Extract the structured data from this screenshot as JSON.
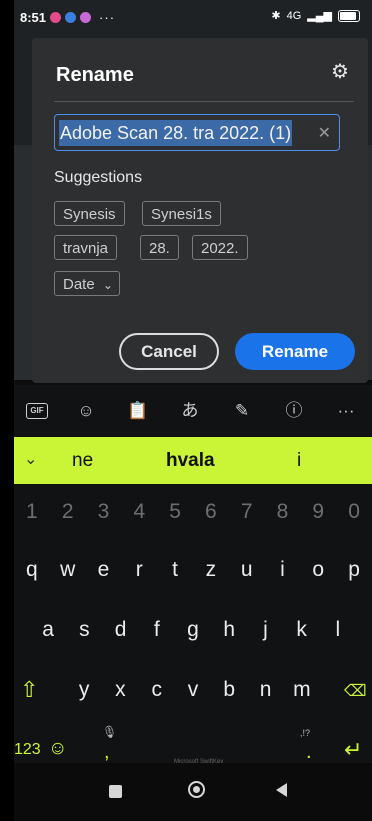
{
  "status_bar": {
    "time": "8:51",
    "more": "···",
    "right_text": "4G"
  },
  "dialog": {
    "title": "Rename",
    "input_value": "Adobe Scan 28. tra 2022. (1)",
    "suggestions_label": "Suggestions",
    "chips_row1": [
      "Synesis",
      "Synesi1s"
    ],
    "chips_row2": [
      "travnja",
      "28.",
      "2022."
    ],
    "date_dropdown": "Date",
    "cancel_label": "Cancel",
    "rename_label": "Rename"
  },
  "keyboard": {
    "suggestions": [
      "ne",
      "hvala",
      "i"
    ],
    "number_row": [
      "1",
      "2",
      "3",
      "4",
      "5",
      "6",
      "7",
      "8",
      "9",
      "0"
    ],
    "row1": [
      "q",
      "w",
      "e",
      "r",
      "t",
      "z",
      "u",
      "i",
      "o",
      "p"
    ],
    "row2": [
      "a",
      "s",
      "d",
      "f",
      "g",
      "h",
      "j",
      "k",
      "l"
    ],
    "row3": [
      "y",
      "x",
      "c",
      "v",
      "b",
      "n",
      "m"
    ],
    "num_toggle": "123",
    "comma": ",",
    "period": ".",
    "punct_hint": ",!?",
    "brand": "Microsoft SwiftKey"
  },
  "colors": {
    "accent": "#c9f536",
    "primary_button": "#1a73e8",
    "dialog_bg": "#2d2f31"
  }
}
